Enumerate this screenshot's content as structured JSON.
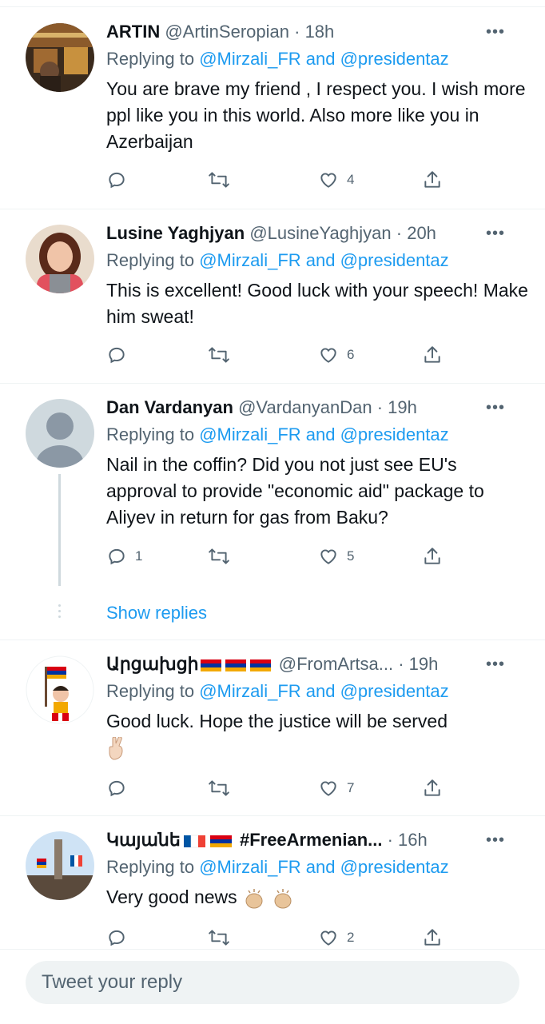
{
  "tweets": [
    {
      "name": "ARTIN",
      "handle": "@ArtinSeropian",
      "time": "18h",
      "replying_prefix": "Replying to",
      "replying_users": "@Mirzali_FR and @presidentaz",
      "text": "You are brave my friend , I respect you. I wish more ppl like you in this world. Also more like you in Azerbaijan",
      "reply_count": "",
      "like_count": "4"
    },
    {
      "name": "Lusine Yaghjyan",
      "handle": "@LusineYaghjyan",
      "time": "20h",
      "replying_prefix": "Replying to",
      "replying_users": "@Mirzali_FR and @presidentaz",
      "text": "This is excellent! Good luck with your speech! Make him sweat!",
      "reply_count": "",
      "like_count": "6"
    },
    {
      "name": "Dan Vardanyan",
      "handle": "@VardanyanDan",
      "time": "19h",
      "replying_prefix": "Replying to",
      "replying_users": "@Mirzali_FR and @presidentaz",
      "text": "Nail in the coffin? Did you not just see EU's approval to provide \"economic aid\" package to Aliyev in return for gas from Baku?",
      "reply_count": "1",
      "like_count": "5"
    },
    {
      "name": "Արցախցի",
      "handle": "@FromArtsa...",
      "time": "19h",
      "replying_prefix": "Replying to",
      "replying_users": "@Mirzali_FR and @presidentaz",
      "text": "Good luck. Hope the justice will be served",
      "reply_count": "",
      "like_count": "7"
    },
    {
      "name": "Կայանե",
      "name_extra": "#FreeArmenian...",
      "time": "16h",
      "replying_prefix": "Replying to",
      "replying_users": "@Mirzali_FR and @presidentaz",
      "text": "Very good news",
      "reply_count": "",
      "like_count": "2"
    }
  ],
  "show_replies_label": "Show replies",
  "more_glyph": "•••",
  "separator": "·",
  "reply_placeholder": "Tweet your reply",
  "colors": {
    "link": "#1d9bf0",
    "muted": "#536471",
    "divider": "#eff3f4",
    "armenia_red": "#d90012",
    "armenia_blue": "#0033a0",
    "armenia_orange": "#f2a800"
  },
  "icons": [
    "reply-icon",
    "retweet-icon",
    "like-icon",
    "share-icon",
    "more-icon"
  ]
}
